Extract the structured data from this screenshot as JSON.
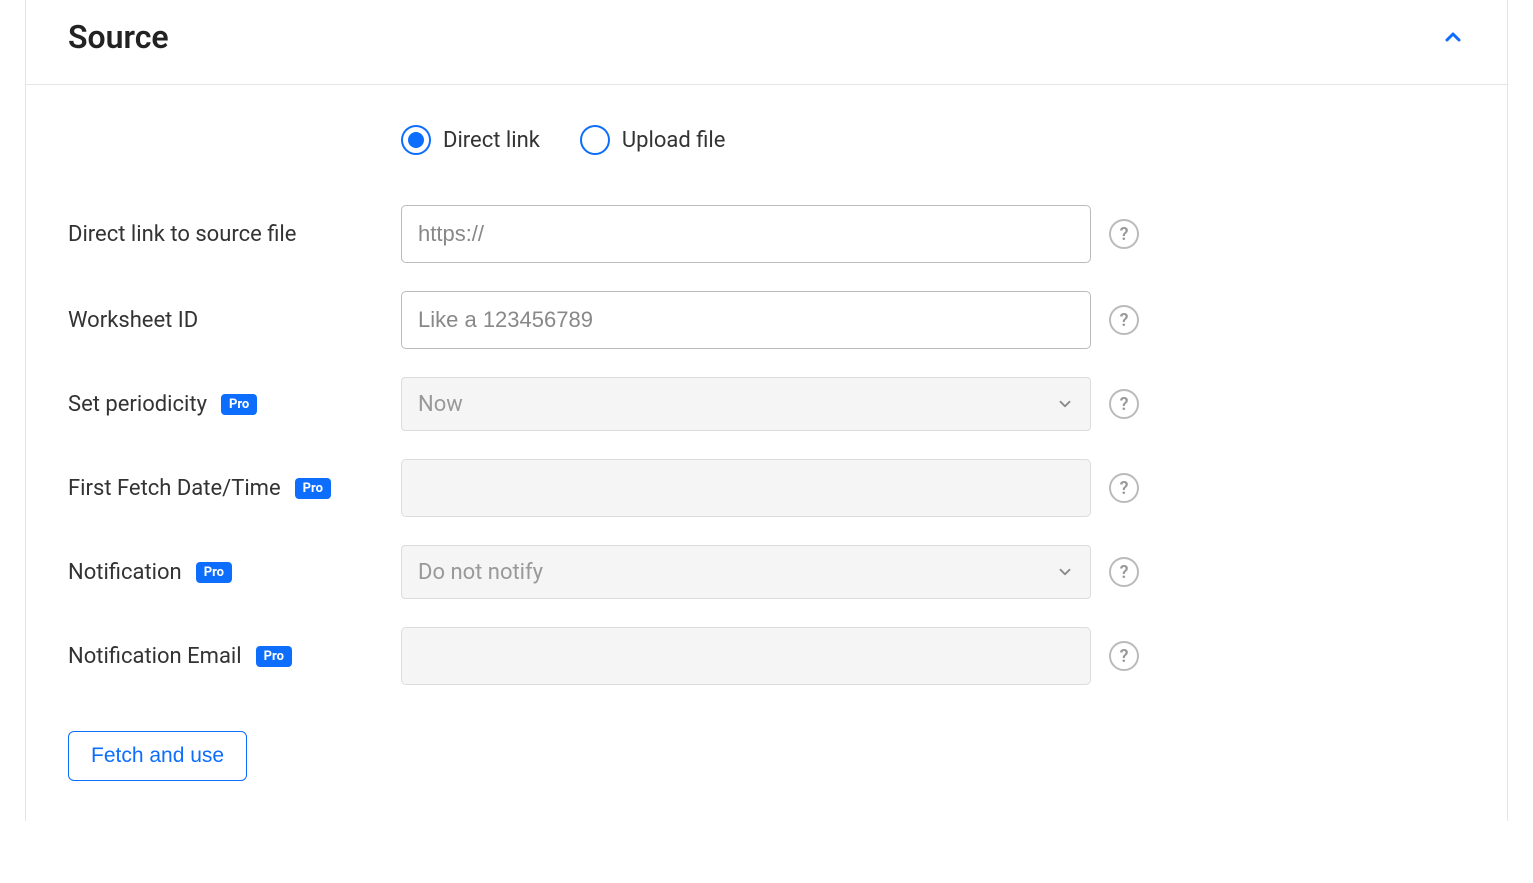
{
  "panel": {
    "title": "Source"
  },
  "radios": {
    "direct_link": "Direct link",
    "upload_file": "Upload file"
  },
  "fields": {
    "direct_link": {
      "label": "Direct link to source file",
      "placeholder": "https://"
    },
    "worksheet_id": {
      "label": "Worksheet ID",
      "placeholder": "Like a 123456789"
    },
    "periodicity": {
      "label": "Set periodicity",
      "value": "Now"
    },
    "first_fetch": {
      "label": "First Fetch Date/Time"
    },
    "notification": {
      "label": "Notification",
      "value": "Do not notify"
    },
    "notification_email": {
      "label": "Notification Email"
    }
  },
  "badges": {
    "pro": "Pro"
  },
  "actions": {
    "fetch": "Fetch and use"
  }
}
